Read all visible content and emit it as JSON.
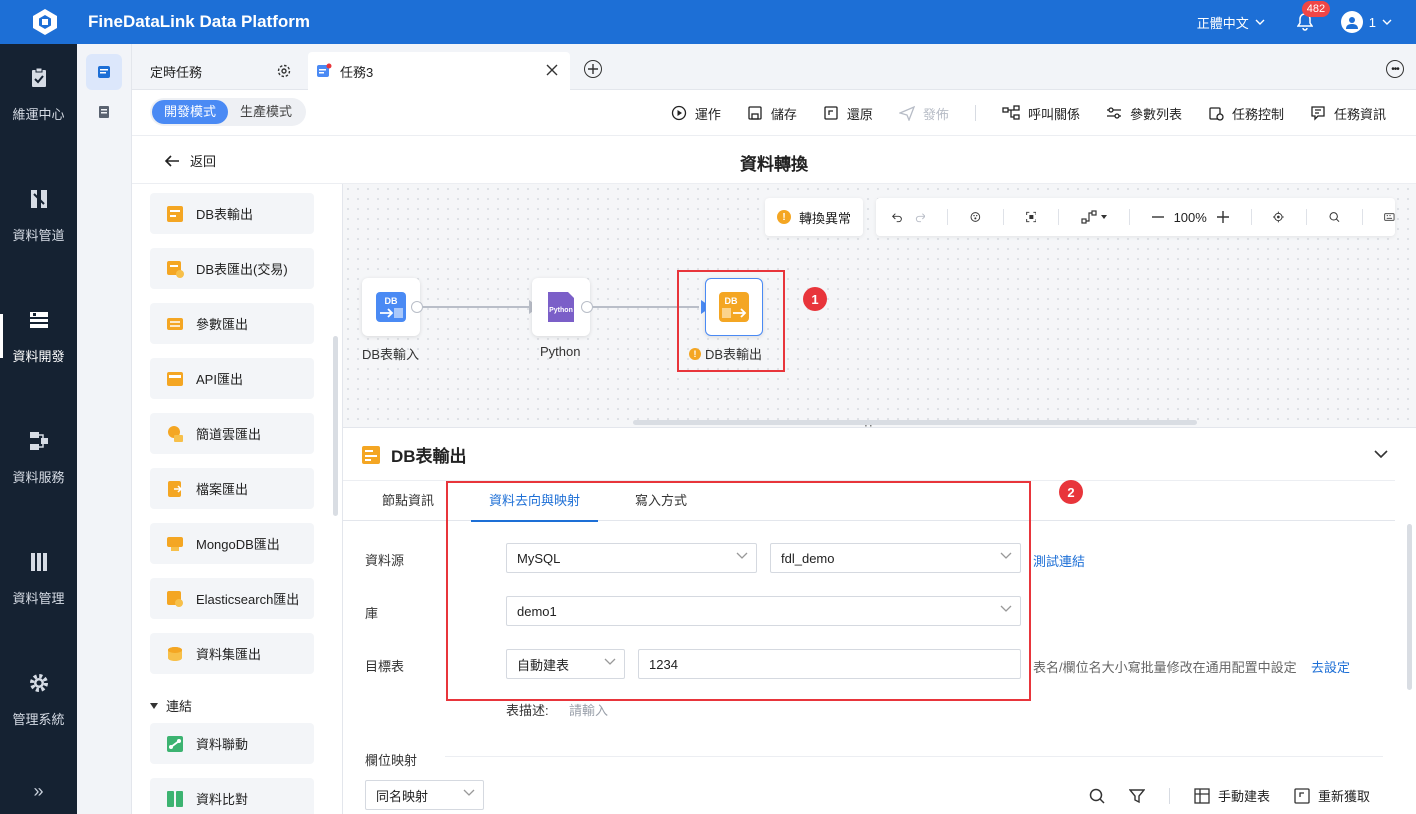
{
  "app": {
    "title": "FineDataLink Data Platform",
    "language": "正體中文",
    "notifications": "482",
    "user": "1"
  },
  "leftnav": [
    {
      "label": "維運中心",
      "icon": "clipboard-check-icon"
    },
    {
      "label": "資料管道",
      "icon": "pipeline-icon"
    },
    {
      "label": "資料開發",
      "icon": "dev-icon",
      "active": true
    },
    {
      "label": "資料服務",
      "icon": "service-icon"
    },
    {
      "label": "資料管理",
      "icon": "manage-icon"
    },
    {
      "label": "管理系統",
      "icon": "gear-icon"
    }
  ],
  "tabs": {
    "schedule": "定時任務",
    "task": "任務3"
  },
  "toolbar": {
    "dev_mode": "開發模式",
    "prod_mode": "生產模式",
    "run": "運作",
    "save": "儲存",
    "restore": "還原",
    "publish": "發佈",
    "call_relation": "呼叫關係",
    "params": "參數列表",
    "task_control": "任務控制",
    "task_info": "任務資訊"
  },
  "title": {
    "back": "返回",
    "page": "資料轉換"
  },
  "components": [
    "DB表輸出",
    "DB表匯出(交易)",
    "參數匯出",
    "API匯出",
    "簡道雲匯出",
    "檔案匯出",
    "MongoDB匯出",
    "Elasticsearch匯出",
    "資料集匯出"
  ],
  "group": {
    "title": "連結",
    "items": [
      "資料聯動",
      "資料比對"
    ]
  },
  "canvas": {
    "warn": "轉換異常",
    "zoom": "100%",
    "nodes": [
      {
        "label": "DB表輸入"
      },
      {
        "label": "Python",
        "icon_text": "Python"
      },
      {
        "label": "DB表輸出"
      }
    ],
    "steps": [
      "1",
      "2"
    ]
  },
  "panel": {
    "title": "DB表輸出",
    "tabs": [
      "節點資訊",
      "資料去向與映射",
      "寫入方式"
    ],
    "fields": {
      "source_label": "資料源",
      "source_type": "MySQL",
      "source_conn": "fdl_demo",
      "test_link": "測試連結",
      "db_label": "庫",
      "db_value": "demo1",
      "table_label": "目標表",
      "table_mode": "自動建表",
      "table_name": "1234",
      "hint": "表名/欄位名大小寫批量修改在通用配置中設定",
      "hint_link": "去設定",
      "desc_label": "表描述:",
      "desc_placeholder": "請輸入"
    },
    "mapping": {
      "title": "欄位映射",
      "mode": "同名映射",
      "manual": "手動建表",
      "refresh": "重新獲取"
    }
  },
  "colors": {
    "primary": "#1d6fd6",
    "nav_bg": "#152232",
    "highlight": "#e8353b",
    "warning": "#f4a623"
  }
}
